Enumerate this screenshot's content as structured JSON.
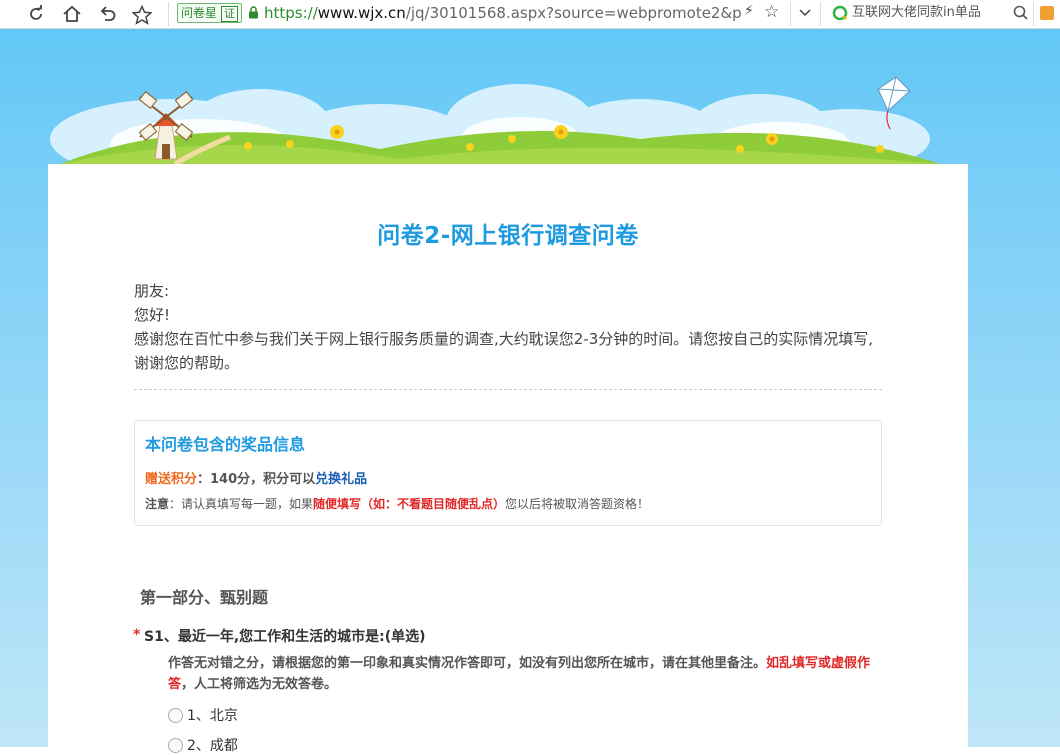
{
  "browser": {
    "site_tag": "问卷星",
    "site_verified": "证",
    "url_scheme": "https://",
    "url_host": "www.wjx.cn",
    "url_rest": "/jq/30101568.aspx?source=webpromote2&p",
    "search_text": "互联网大佬同款in单品",
    "icons": [
      "refresh-icon",
      "home-icon",
      "undo-icon",
      "star-icon",
      "lock-icon",
      "bolt-icon",
      "bookmark-star-icon",
      "chevron-down-icon",
      "search-logo-icon",
      "search-icon"
    ]
  },
  "survey": {
    "title": "问卷2-网上银行调查问卷",
    "intro": {
      "greeting1": "朋友:",
      "greeting2": "您好!",
      "body": "感谢您在百忙中参与我们关于网上银行服务质量的调查,大约耽误您2-3分钟的时间。请您按自己的实际情况填写,谢谢您的帮助。"
    },
    "prize": {
      "title": "本问卷包含的奖品信息",
      "points_label": "赠送积分",
      "points_value": "：140分，积分可以",
      "points_link": "兑换礼品",
      "note_label": "注意",
      "note_text": "：请认真填写每一题，如果",
      "note_red": "随便填写（如：不看题目随便乱点）",
      "note_tail": "您以后将被取消答题资格！"
    },
    "section_title": "第一部分、甄别题",
    "question": {
      "required_mark": "*",
      "title": "S1、最近一年,您工作和生活的城市是:(单选)",
      "desc_main": "作答无对错之分，请根据您的第一印象和真实情况作答即可，如没有列出您所在城市，请在其他里备注。",
      "desc_red": "如乱填写或虚假作答",
      "desc_tail": "，人工将筛选为无效答卷。",
      "options": [
        "1、北京",
        "2、成都"
      ]
    }
  }
}
